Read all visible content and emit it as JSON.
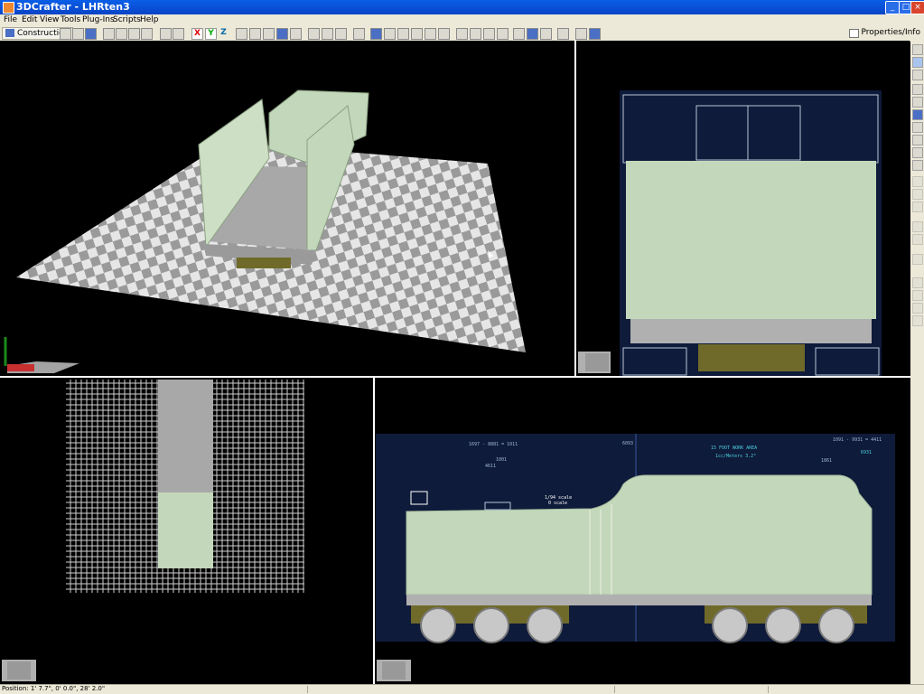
{
  "window": {
    "title": "3DCrafter - LHRten3"
  },
  "menu": {
    "file": "File",
    "edit": "Edit",
    "view": "View",
    "tools": "Tools",
    "plugins": "Plug-Ins",
    "scripts": "Scripts",
    "help": "Help"
  },
  "toolbar": {
    "mode_label": "Construction",
    "properties_label": "Properties/Info",
    "x_label": "X",
    "y_label": "Y",
    "z_label": "Z"
  },
  "status": {
    "position": "Position: 1' 7.7\", 0' 0.0\", 28' 2.0\""
  },
  "blueprint": {
    "top_left": "1697 - 8881 = 1011",
    "top_left_sub": "4611",
    "top_left_sub2": "1001",
    "center_top": "6093",
    "scale_a": "15 FOOT WORK AREA",
    "scale_b": "1cc/Meters 3.2°",
    "right_top": "1091 - 9931 = 4411",
    "right_sub": "6931",
    "right_sub2": "1861",
    "note_a": "1/94 scale",
    "note_b": "0 scale"
  },
  "colors": {
    "model": "#c3d8ba",
    "deck": "#b0b0b0",
    "blueprint": "#0f1b3a",
    "chassis": "#6f6a2a"
  }
}
